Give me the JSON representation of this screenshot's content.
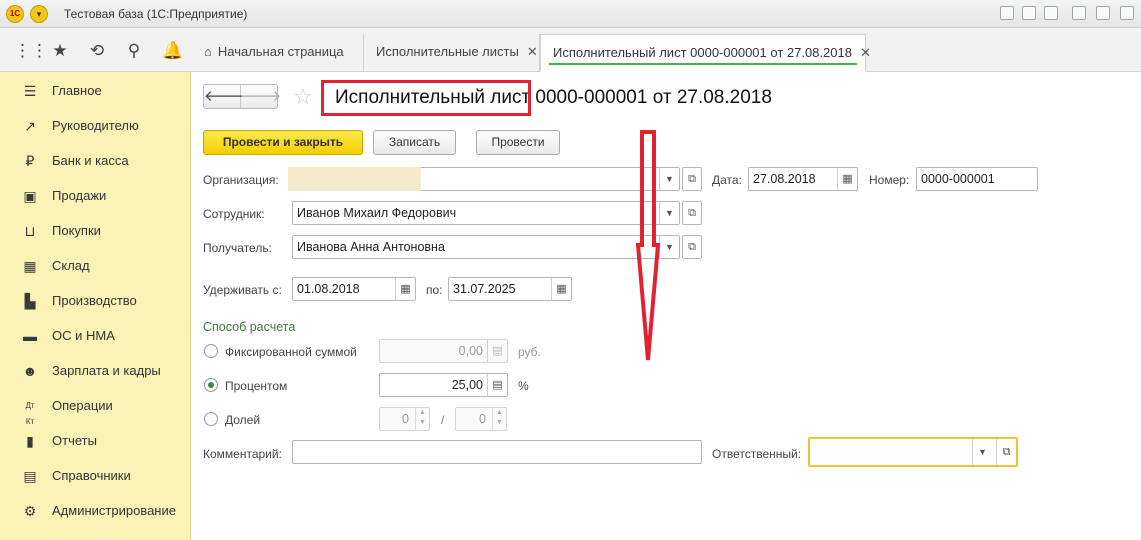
{
  "window": {
    "title": "Тестовая база  (1С:Предприятие)"
  },
  "tabs": [
    {
      "label": "Начальная страница"
    },
    {
      "label": "Исполнительные листы"
    },
    {
      "label": "Исполнительный лист 0000-000001 от 27.08.2018"
    }
  ],
  "sidebar": {
    "items": [
      {
        "label": "Главное",
        "icon": "menu-icon"
      },
      {
        "label": "Руководителю",
        "icon": "trend-icon"
      },
      {
        "label": "Банк и касса",
        "icon": "ruble-icon"
      },
      {
        "label": "Продажи",
        "icon": "bag-icon"
      },
      {
        "label": "Покупки",
        "icon": "cart-icon"
      },
      {
        "label": "Склад",
        "icon": "warehouse-icon"
      },
      {
        "label": "Производство",
        "icon": "factory-icon"
      },
      {
        "label": "ОС и НМА",
        "icon": "truck-icon"
      },
      {
        "label": "Зарплата и кадры",
        "icon": "person-icon"
      },
      {
        "label": "Операции",
        "icon": "debit-credit-icon"
      },
      {
        "label": "Отчеты",
        "icon": "bar-chart-icon"
      },
      {
        "label": "Справочники",
        "icon": "book-icon"
      },
      {
        "label": "Администрирование",
        "icon": "gear-icon"
      }
    ]
  },
  "document": {
    "title_part1": "Исполнительный лист",
    "title_part2": " 0000-000001 от 27.08.2018"
  },
  "toolbar": {
    "post_close": "Провести и закрыть",
    "save": "Записать",
    "post": "Провести"
  },
  "form": {
    "org_label": "Организация:",
    "org_value": "",
    "date_label": "Дата:",
    "date_value": "27.08.2018",
    "number_label": "Номер:",
    "number_value": "0000-000001",
    "employee_label": "Сотрудник:",
    "employee_value": "Иванов Михаил Федорович",
    "recipient_label": "Получатель:",
    "recipient_value": "Иванова Анна Антоновна",
    "hold_from_label": "Удерживать с:",
    "hold_from_value": "01.08.2018",
    "hold_to_label": "по:",
    "hold_to_value": "31.07.2025",
    "calc_section": "Способ расчета",
    "fixed_label": "Фиксированной суммой",
    "fixed_value": "0,00",
    "fixed_unit": "руб.",
    "percent_label": "Процентом",
    "percent_value": "25,00",
    "percent_unit": "%",
    "share_label": "Долей",
    "share_num": "0",
    "share_sep": "/",
    "share_den": "0",
    "comment_label": "Комментарий:",
    "comment_value": "",
    "responsible_label": "Ответственный:",
    "responsible_value": ""
  },
  "colors": {
    "sidebar_bg": "#fbf2b8",
    "primary_button": "#f3cf00",
    "highlight_red": "#e0232f",
    "section_green": "#3a7d3a"
  }
}
